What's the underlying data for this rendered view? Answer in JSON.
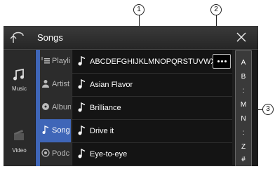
{
  "callouts": {
    "c1": "1",
    "c2": "2",
    "c3": "3"
  },
  "header": {
    "title": "Songs",
    "back_icon": "back-arrow-icon",
    "close_icon": "close-icon"
  },
  "sources": [
    {
      "label": "Music",
      "icon": "music-note-icon"
    },
    {
      "label": "Video",
      "icon": "video-clapper-icon"
    }
  ],
  "categories": [
    {
      "label": "Playli",
      "icon": "playlist-icon",
      "active": false
    },
    {
      "label": "Artist",
      "icon": "artist-icon",
      "active": false
    },
    {
      "label": "Albun",
      "icon": "album-icon",
      "active": false
    },
    {
      "label": "Song",
      "icon": "music-note-icon",
      "active": true
    },
    {
      "label": "Podc",
      "icon": "podcast-icon",
      "active": false
    }
  ],
  "songs": [
    {
      "title": "ABCDEFGHIJKLMNOPQRSTUVWXY"
    },
    {
      "title": "Asian Flavor"
    },
    {
      "title": "Brilliance"
    },
    {
      "title": "Drive it"
    },
    {
      "title": "Eye-to-eye"
    }
  ],
  "alphabet_index": [
    "A",
    "B",
    ":",
    "M",
    "N",
    ":",
    "Z",
    "#"
  ],
  "colors": {
    "accent": "#3f66b8",
    "background": "#1f1f1f"
  }
}
